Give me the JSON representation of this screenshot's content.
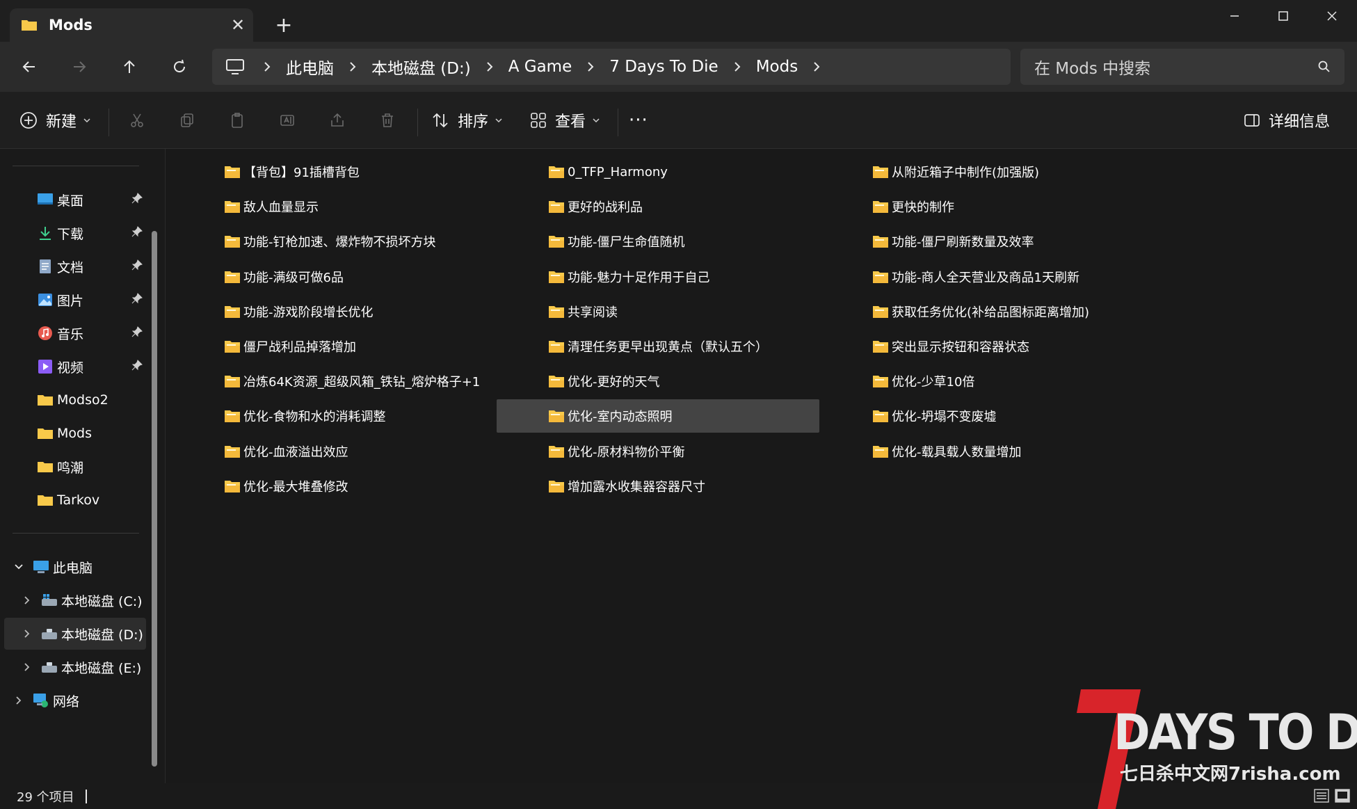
{
  "window": {
    "tab_title": "Mods",
    "new_tab_symbol": "+",
    "close_tab_symbol": "✕"
  },
  "address": {
    "crumbs": [
      "此电脑",
      "本地磁盘 (D:)",
      "A Game",
      "7 Days To Die",
      "Mods"
    ]
  },
  "search": {
    "placeholder": "在 Mods 中搜索"
  },
  "commands": {
    "new_label": "新建",
    "sort_label": "排序",
    "view_label": "查看",
    "details_label": "详细信息",
    "more_symbol": "···"
  },
  "sidebar": {
    "quick": [
      {
        "label": "桌面",
        "icon": "desktop-icon",
        "pinned": true
      },
      {
        "label": "下载",
        "icon": "download-icon",
        "pinned": true
      },
      {
        "label": "文档",
        "icon": "document-icon",
        "pinned": true
      },
      {
        "label": "图片",
        "icon": "pictures-icon",
        "pinned": true
      },
      {
        "label": "音乐",
        "icon": "music-icon",
        "pinned": true
      },
      {
        "label": "视频",
        "icon": "video-icon",
        "pinned": true
      },
      {
        "label": "Modso2",
        "icon": "folder-icon",
        "pinned": false
      },
      {
        "label": "Mods",
        "icon": "folder-icon",
        "pinned": false
      },
      {
        "label": "鸣潮",
        "icon": "folder-icon",
        "pinned": false
      },
      {
        "label": "Tarkov",
        "icon": "folder-icon",
        "pinned": false
      }
    ],
    "this_pc": "此电脑",
    "drives": [
      "本地磁盘 (C:)",
      "本地磁盘 (D:)",
      "本地磁盘 (E:)"
    ],
    "network": "网络"
  },
  "files": [
    "【背包】91插槽背包",
    "0_TFP_Harmony",
    "从附近箱子中制作(加强版)",
    "敌人血量显示",
    "更好的战利品",
    "更快的制作",
    "功能-钉枪加速、爆炸物不损坏方块",
    "功能-僵尸生命值随机",
    "功能-僵尸刷新数量及效率",
    "功能-满级可做6品",
    "功能-魅力十足作用于自己",
    "功能-商人全天营业及商品1天刷新",
    "功能-游戏阶段增长优化",
    "共享阅读",
    "获取任务优化(补给品图标距离增加)",
    "僵尸战利品掉落增加",
    "清理任务更早出现黄点（默认五个）",
    "突出显示按钮和容器状态",
    "冶炼64K资源_超级风箱_铁钻_熔炉格子+1",
    "优化-更好的天气",
    "优化-少草10倍",
    "优化-食物和水的消耗调整",
    "优化-室内动态照明",
    "优化-坍塌不变废墟",
    "优化-血液溢出效应",
    "优化-原材料物价平衡",
    "优化-载具载人数量增加",
    "优化-最大堆叠修改",
    "增加露水收集器容器尺寸"
  ],
  "selected_file": "优化-室内动态照明",
  "status": {
    "item_count": "29 个项目"
  },
  "colors": {
    "accent": "#4cc2ff",
    "folder": "#f8c94a",
    "background": "#191919"
  }
}
